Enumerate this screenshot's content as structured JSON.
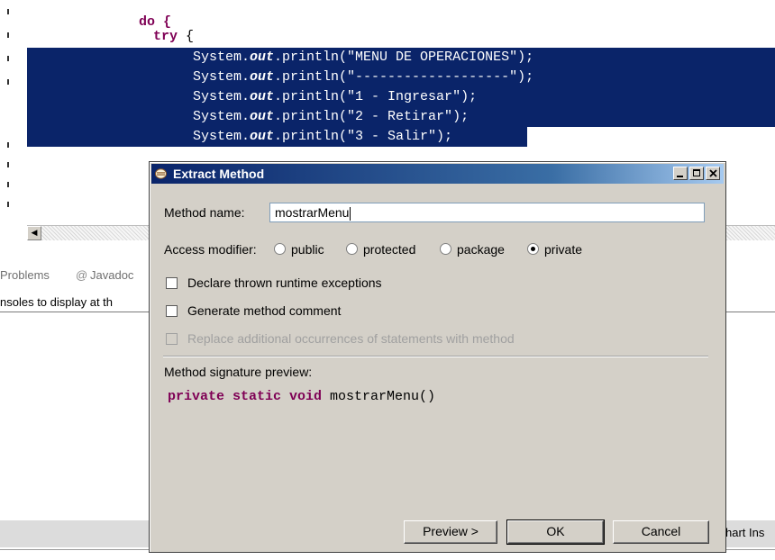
{
  "editor": {
    "header_fragment": "do {",
    "try_keyword": "try",
    "try_brace": " {",
    "lines": [
      {
        "prefix": "System.",
        "field": "out",
        "suffix": ".println(\"MENU DE OPERACIONES\");"
      },
      {
        "prefix": "System.",
        "field": "out",
        "suffix": ".println(\"-------------------\");"
      },
      {
        "prefix": "System.",
        "field": "out",
        "suffix": ".println(\"1 - Ingresar\");"
      },
      {
        "prefix": "System.",
        "field": "out",
        "suffix": ".println(\"2 - Retirar\");"
      },
      {
        "prefix": "System.",
        "field": "out",
        "suffix": ".println(\"3 - Salir\");"
      }
    ],
    "scroll_left_arrow": "◀"
  },
  "panel": {
    "tab_problems": "Problems",
    "tab_javadoc_at": "@",
    "tab_javadoc": "Javadoc",
    "console_message": "nsoles to display at th",
    "status_right": "hart Ins"
  },
  "dialog": {
    "title": "Extract Method",
    "method_name_label": "Method name:",
    "method_name_value": "mostrarMenu",
    "access_modifier_label": "Access modifier:",
    "access_options": [
      {
        "label": "public",
        "selected": false
      },
      {
        "label": "protected",
        "selected": false
      },
      {
        "label": "package",
        "selected": false
      },
      {
        "label": "private",
        "selected": true
      }
    ],
    "checkboxes": [
      {
        "label": "Declare thrown runtime exceptions",
        "checked": false,
        "enabled": true
      },
      {
        "label": "Generate method comment",
        "checked": false,
        "enabled": true
      },
      {
        "label": "Replace additional occurrences of statements with method",
        "checked": false,
        "enabled": false
      }
    ],
    "signature_label": "Method signature preview:",
    "signature_keywords": "private static void",
    "signature_rest": " mostrarMenu()",
    "buttons": {
      "preview": "Preview >",
      "ok": "OK",
      "cancel": "Cancel"
    }
  },
  "colors": {
    "selection": "#0a2469",
    "keyword": "#7f0055",
    "titlebar_start": "#0a246a",
    "dialog_bg": "#d4d0c8"
  }
}
